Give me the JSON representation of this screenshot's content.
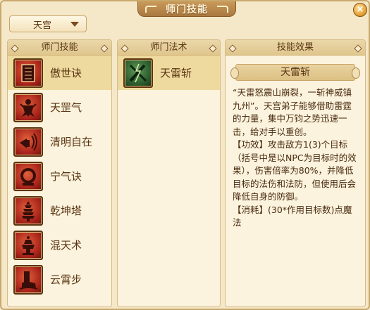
{
  "window": {
    "title": "师门技能",
    "close_glyph": "×"
  },
  "sect_select": {
    "value": "天宫"
  },
  "skills_panel": {
    "header": "师门技能",
    "items": [
      {
        "label": "傲世诀",
        "icon": "scroll-icon"
      },
      {
        "label": "天罡气",
        "icon": "warrior-icon"
      },
      {
        "label": "清明自在",
        "icon": "horn-icon"
      },
      {
        "label": "宁气诀",
        "icon": "ring-icon"
      },
      {
        "label": "乾坤塔",
        "icon": "pagoda-icon"
      },
      {
        "label": "混天术",
        "icon": "lamp-icon"
      },
      {
        "label": "云霄步",
        "icon": "boot-icon"
      }
    ],
    "selected_index": 0
  },
  "spells_panel": {
    "header": "师门法术",
    "items": [
      {
        "label": "天雷斩",
        "icon": "lightning-blade-icon"
      }
    ],
    "selected_index": 0
  },
  "effect_panel": {
    "header": "技能效果",
    "name": "天雷斩",
    "paragraphs": [
      "“天雷怒震山崩裂，一斩神威镇九州”。天宫弟子能够借助雷霆的力量，集中万钧之势迅速一击，给对手以重创。",
      "【功效】攻击敌方1(3)个目标（括号中是以NPC为目标时的效果），伤害倍率为80%，并降低目标的法伤和法防，但使用后会降低自身的防御。",
      "【消耗】(30*作用目标数)点魔法"
    ]
  },
  "colors": {
    "panel_bg": "#fbf3dd",
    "selected_row": "#eeda9f",
    "text": "#5a3412",
    "icon_red": "#a8221a",
    "icon_green": "#2a5a2c"
  }
}
